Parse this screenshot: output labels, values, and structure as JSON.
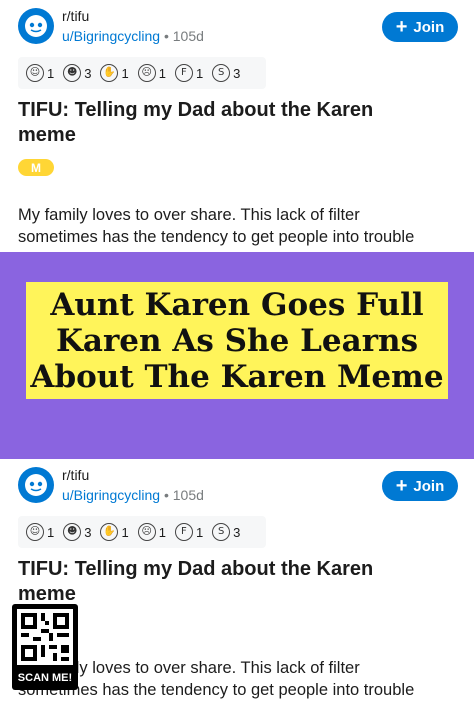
{
  "post": {
    "subreddit": "r/tifu",
    "user": "u/Bigringcycling",
    "age": "105d",
    "join_label": "Join",
    "awards": [
      {
        "icon": "award-1-icon",
        "glyph": "☺",
        "count": "1"
      },
      {
        "icon": "award-2-icon",
        "glyph": "☻",
        "count": "3"
      },
      {
        "icon": "award-3-icon",
        "glyph": "✋",
        "count": "1"
      },
      {
        "icon": "award-4-icon",
        "glyph": "☹",
        "count": "1"
      },
      {
        "icon": "award-5-icon",
        "glyph": "F",
        "count": "1"
      },
      {
        "icon": "award-6-icon",
        "glyph": "S",
        "count": "3"
      }
    ],
    "title_line1": "TIFU: Telling my Dad about the Karen",
    "title_line2": "meme",
    "flair": "M",
    "body_line1": "My family loves to over share. This lack of filter",
    "body_line2": "sometimes has the tendency to get people into trouble"
  },
  "headline": {
    "line1": "Aunt Karen Goes Full",
    "line2": "Karen As She Learns",
    "line3": "About The Karen Meme"
  },
  "qr": {
    "label": "SCAN ME!"
  },
  "colors": {
    "accent": "#0079d3",
    "banner": "#8a64e0",
    "headline_bg": "#fff45a",
    "flair": "#ffd635"
  }
}
